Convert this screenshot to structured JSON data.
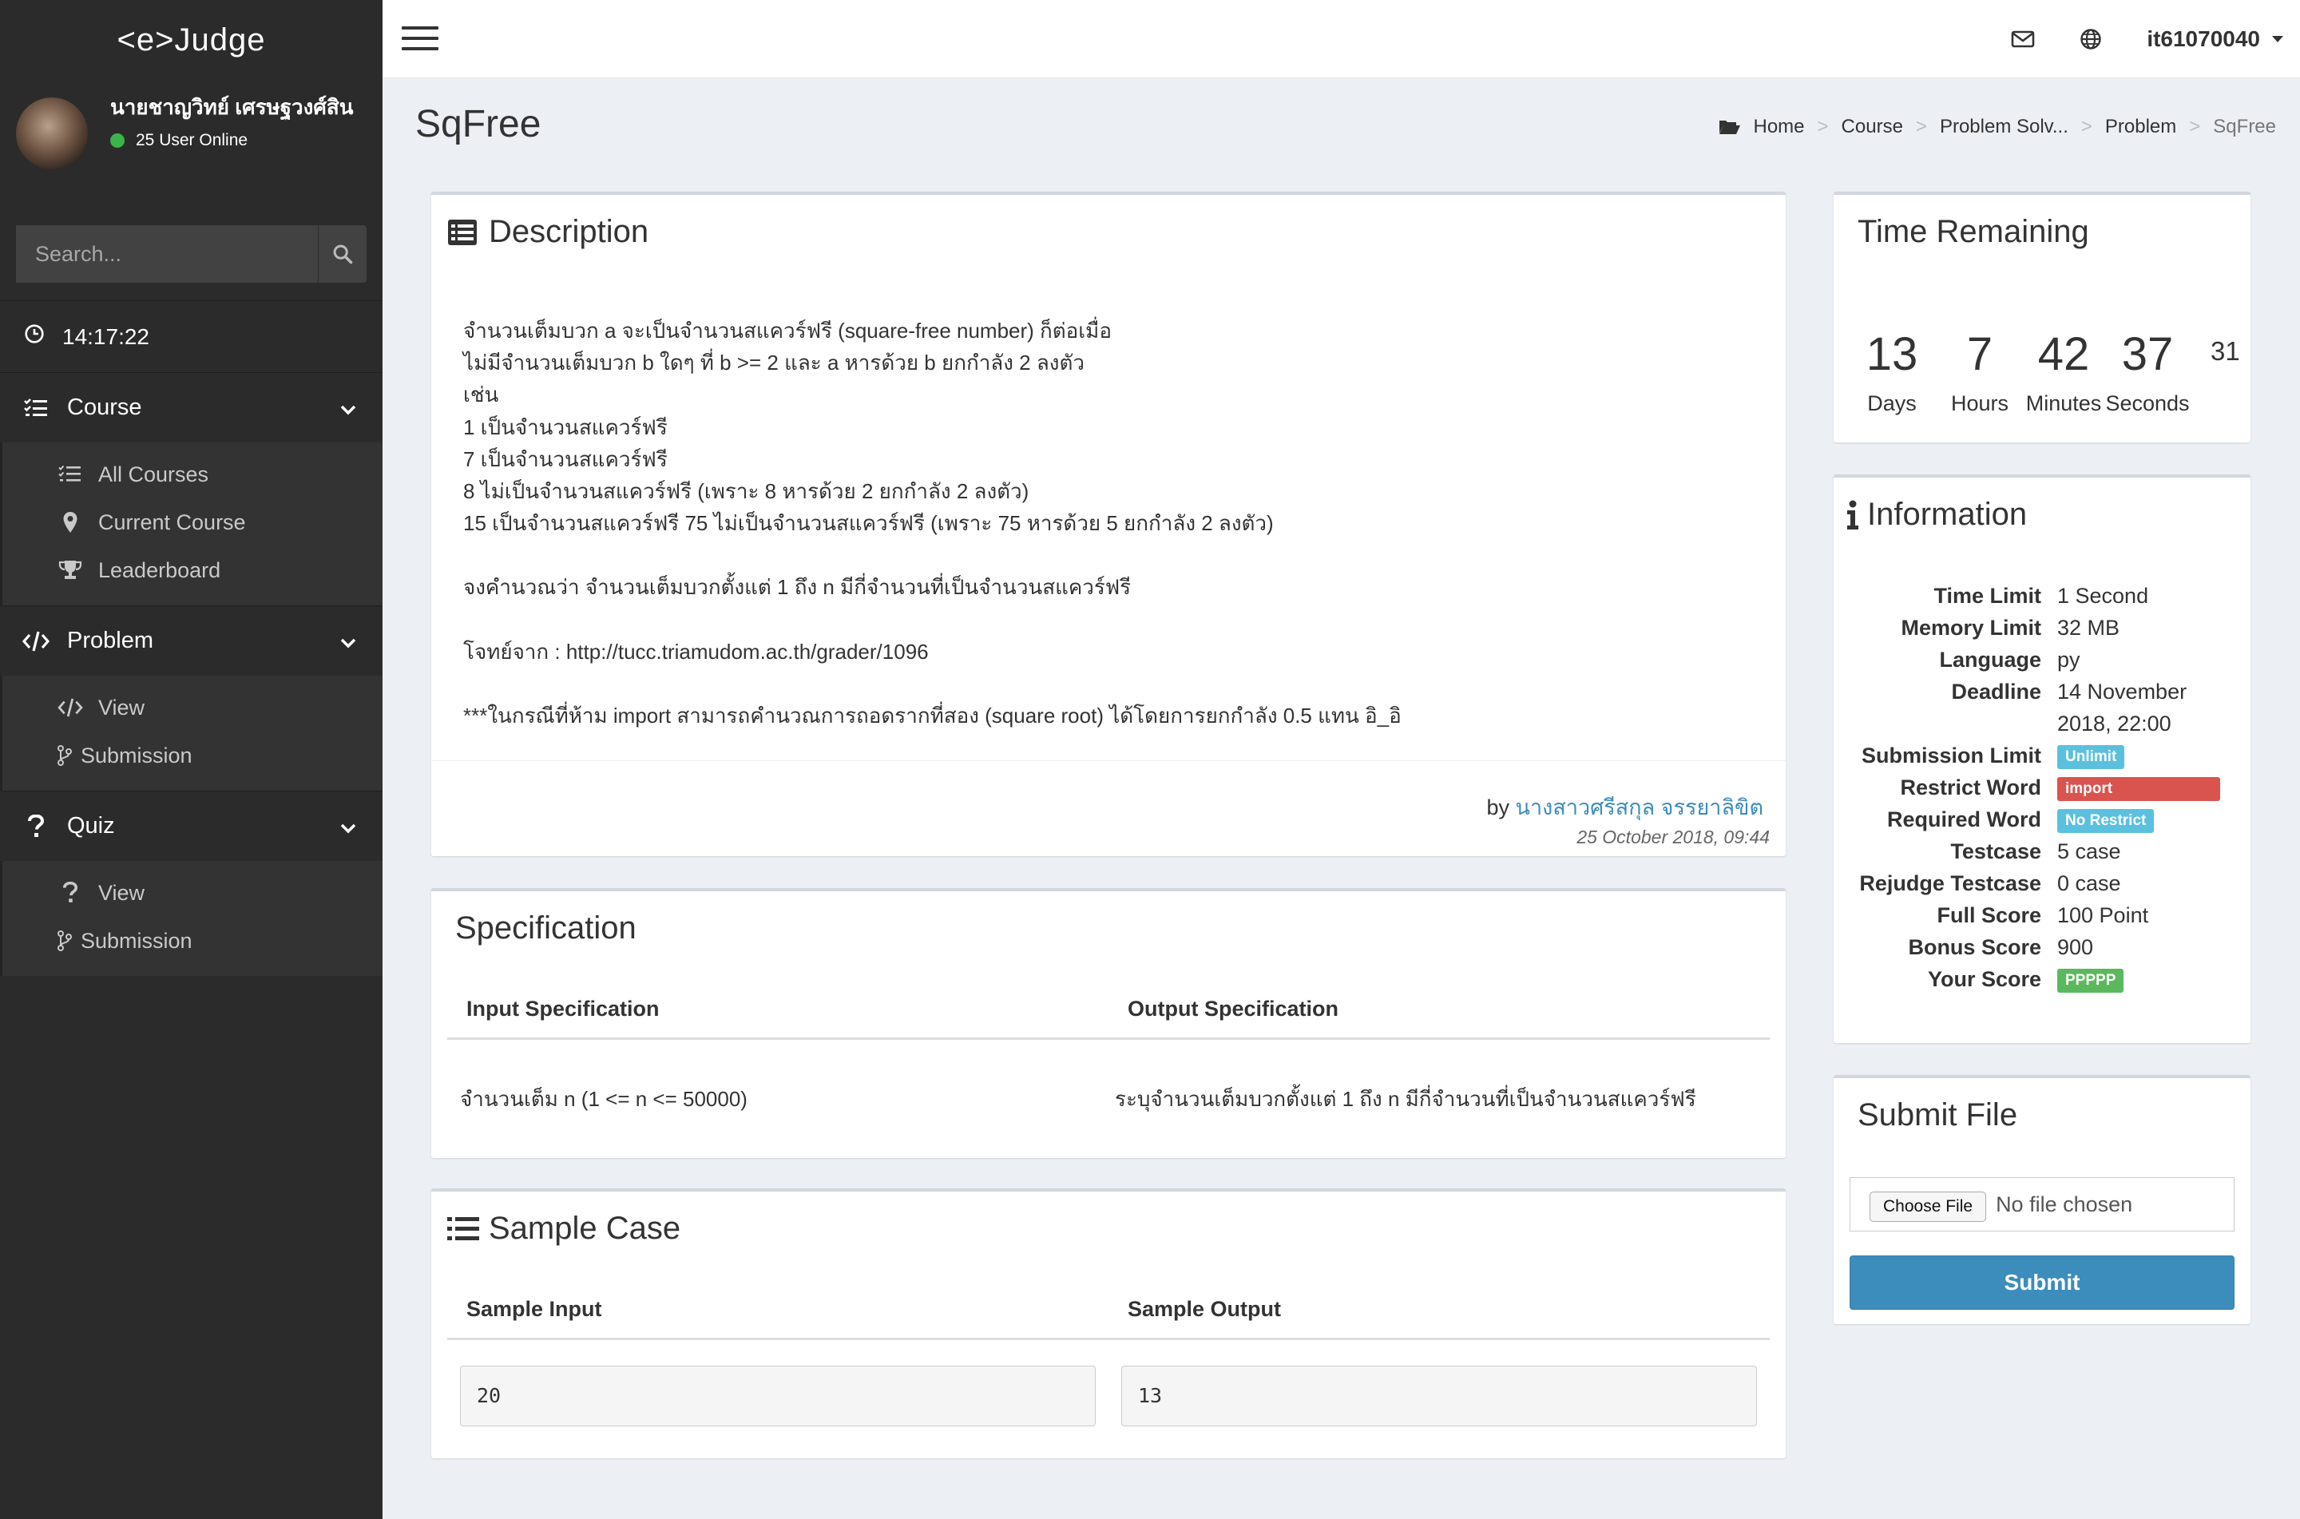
{
  "app": {
    "logo": "<e>Judge"
  },
  "user": {
    "name": "นายชาญวิทย์ เศรษฐวงศ์สิน",
    "online_status": "25 User Online"
  },
  "search": {
    "placeholder": "Search..."
  },
  "sidebar": {
    "clock": "14:17:22",
    "course": {
      "label": "Course",
      "items": [
        {
          "label": "All Courses",
          "icon": "list-icon"
        },
        {
          "label": "Current Course",
          "icon": "map-marker-icon"
        },
        {
          "label": "Leaderboard",
          "icon": "trophy-icon"
        }
      ]
    },
    "problem": {
      "label": "Problem",
      "items": [
        {
          "label": "View",
          "icon": "code-icon"
        },
        {
          "label": "Submission",
          "icon": "branch-icon"
        }
      ]
    },
    "quiz": {
      "label": "Quiz",
      "items": [
        {
          "label": "View",
          "icon": "question-icon"
        },
        {
          "label": "Submission",
          "icon": "branch-icon"
        }
      ]
    }
  },
  "topbar": {
    "username": "it61070040"
  },
  "page": {
    "title": "SqFree",
    "breadcrumb": [
      "Home",
      "Course",
      "Problem Solv...",
      "Problem",
      "SqFree"
    ]
  },
  "description": {
    "title": "Description",
    "lines": [
      "จำนวนเต็มบวก a จะเป็นจำนวนสแควร์ฟรี (square-free number) ก็ต่อเมื่อ",
      "ไม่มีจำนวนเต็มบวก b ใดๆ ที่ b >= 2 และ a หารด้วย b ยกกำลัง 2 ลงตัว",
      "เช่น",
      "1 เป็นจำนวนสแควร์ฟรี",
      "7 เป็นจำนวนสแควร์ฟรี",
      "8 ไม่เป็นจำนวนสแควร์ฟรี (เพราะ 8 หารด้วย 2 ยกกำลัง 2 ลงตัว)",
      "15 เป็นจำนวนสแควร์ฟรี 75 ไม่เป็นจำนวนสแควร์ฟรี (เพราะ 75 หารด้วย 5 ยกกำลัง 2 ลงตัว)",
      "จงคำนวณว่า จำนวนเต็มบวกตั้งแต่ 1 ถึง n มีกี่จำนวนที่เป็นจำนวนสแควร์ฟรี",
      "โจทย์จาก : http://tucc.triamudom.ac.th/grader/1096",
      "***ในกรณีที่ห้าม import สามารถคำนวณการถอดรากที่สอง (square root) ได้โดยการยกกำลัง 0.5 แทน อิ_อิ"
    ],
    "by_prefix": "by",
    "author": "นางสาวศรีสกุล จรรยาลิขิต",
    "date": "25 October 2018, 09:44"
  },
  "specification": {
    "title": "Specification",
    "input_header": "Input Specification",
    "output_header": "Output Specification",
    "input": "จำนวนเต็ม n (1 <= n <= 50000)",
    "output": "ระบุจำนวนเต็มบวกตั้งแต่ 1 ถึง n มีกี่จำนวนที่เป็นจำนวนสแควร์ฟรี"
  },
  "sample": {
    "title": "Sample Case",
    "input_header": "Sample Input",
    "output_header": "Sample Output",
    "input": "20",
    "output": "13"
  },
  "time_remaining": {
    "title": "Time Remaining",
    "days": "13",
    "hours": "7",
    "minutes": "42",
    "seconds": "37",
    "extra": "31",
    "days_label": "Days",
    "hours_label": "Hours",
    "minutes_label": "Minutes",
    "seconds_label": "Seconds"
  },
  "information": {
    "title": "Information",
    "time_limit": {
      "k": "Time Limit",
      "v": "1 Second"
    },
    "memory_limit": {
      "k": "Memory Limit",
      "v": "32 MB"
    },
    "language": {
      "k": "Language",
      "v": "py"
    },
    "deadline": {
      "k": "Deadline",
      "v1": "14 November",
      "v2": "2018, 22:00"
    },
    "submission_limit": {
      "k": "Submission Limit",
      "v": "Unlimit"
    },
    "restrict_word": {
      "k": "Restrict Word",
      "v": "import"
    },
    "required_word": {
      "k": "Required Word",
      "v": "No Restrict"
    },
    "testcase": {
      "k": "Testcase",
      "v": "5 case"
    },
    "rejudge_testcase": {
      "k": "Rejudge Testcase",
      "v": "0 case"
    },
    "full_score": {
      "k": "Full Score",
      "v": "100 Point"
    },
    "bonus_score": {
      "k": "Bonus Score",
      "v": "900"
    },
    "your_score": {
      "k": "Your Score",
      "v": "PPPPP"
    }
  },
  "submit": {
    "title": "Submit File",
    "choose_label": "Choose File",
    "no_file": "No file chosen",
    "button": "Submit"
  },
  "colors": {
    "sidebar": "#2b2b2b",
    "primary": "#3c8dbc",
    "badge_info": "#5bc0de",
    "badge_danger": "#d9534f",
    "badge_success": "#5cb85c",
    "online": "#3bb54a"
  }
}
